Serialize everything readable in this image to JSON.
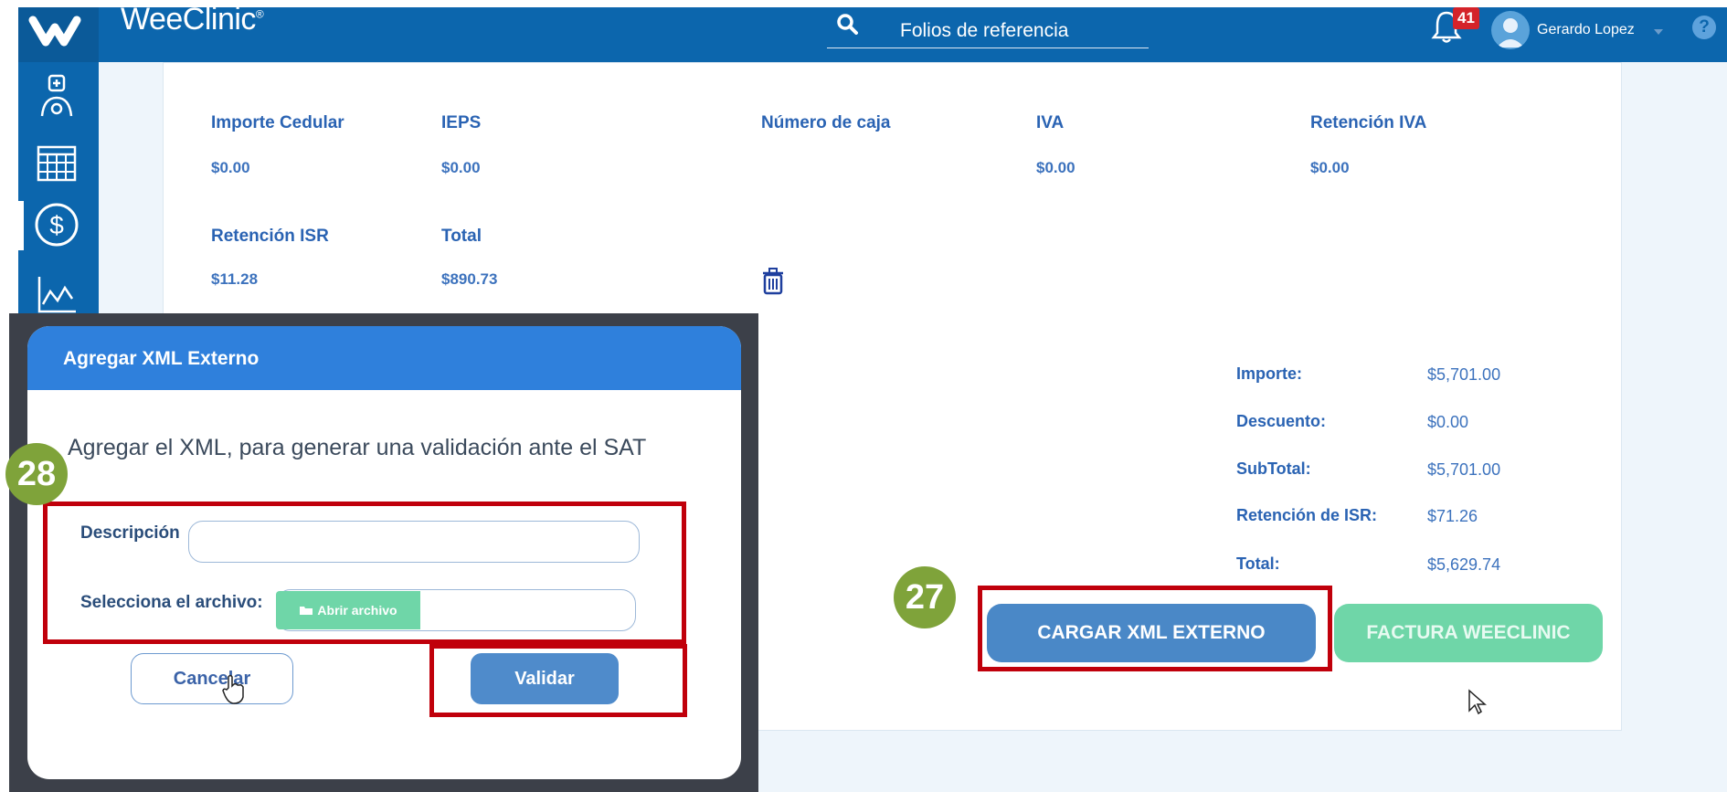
{
  "app": {
    "brand": "WeeClinic",
    "brand_mark": "®",
    "search_label": "Folios de referencia",
    "notifications_count": "41",
    "user_name": "Gerardo Lopez"
  },
  "details": {
    "row1": [
      {
        "label": "Importe Cedular",
        "value": "$0.00"
      },
      {
        "label": "IEPS",
        "value": "$0.00"
      },
      {
        "label": "Número de caja",
        "value": ""
      },
      {
        "label": "IVA",
        "value": "$0.00"
      },
      {
        "label": "Retención IVA",
        "value": "$0.00"
      }
    ],
    "row2": [
      {
        "label": "Retención ISR",
        "value": "$11.28"
      },
      {
        "label": "Total",
        "value": "$890.73"
      }
    ]
  },
  "summary": [
    {
      "label": "Importe:",
      "value": "$5,701.00"
    },
    {
      "label": "Descuento:",
      "value": "$0.00"
    },
    {
      "label": "SubTotal:",
      "value": "$5,701.00"
    },
    {
      "label": "Retención de ISR:",
      "value": "$71.26"
    },
    {
      "label": "Total:",
      "value": "$5,629.74"
    }
  ],
  "actions": {
    "cargar_label": "CARGAR XML EXTERNO",
    "factura_label": "FACTURA WEECLINIC"
  },
  "steps": {
    "step27": "27",
    "step28": "28"
  },
  "modal": {
    "title": "Agregar XML Externo",
    "message": "Agregar el XML, para generar una validación ante el SAT",
    "description_label": "Descripción",
    "file_label": "Selecciona el archivo:",
    "file_button": "Abrir archivo",
    "cancel_label": "Cancelar",
    "validate_label": "Validar"
  },
  "colors": {
    "primary": "#0c66ad",
    "accent_green": "#6fd6a8",
    "step_green": "#7fa33a",
    "highlight_red": "#c0000b"
  }
}
